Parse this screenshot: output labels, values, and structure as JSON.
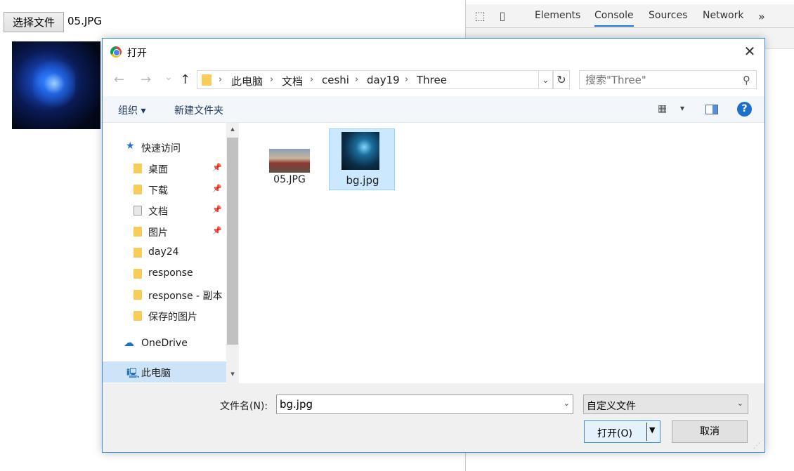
{
  "page": {
    "file_button_label": "选择文件",
    "selected_file_name": "05.JPG"
  },
  "devtools": {
    "tabs": [
      "Elements",
      "Console",
      "Sources",
      "Network"
    ],
    "active_tab": "Console",
    "more_tabs_glyph": "»"
  },
  "dialog": {
    "title": "打开",
    "close_glyph": "✕",
    "nav": {
      "back_glyph": "←",
      "forward_glyph": "→",
      "recent_glyph": "⌄",
      "up_glyph": "↑",
      "breadcrumbs": [
        "此电脑",
        "文档",
        "ceshi",
        "day19",
        "Three"
      ],
      "search_placeholder": "搜索\"Three\""
    },
    "toolbar": {
      "organize_label": "组织 ▾",
      "new_folder_label": "新建文件夹",
      "help_glyph": "?"
    },
    "sidebar": {
      "quick_access_label": "快速访问",
      "items": [
        {
          "label": "桌面",
          "pinned": true
        },
        {
          "label": "下载",
          "pinned": true
        },
        {
          "label": "文档",
          "pinned": true
        },
        {
          "label": "图片",
          "pinned": true
        },
        {
          "label": "day24",
          "pinned": false
        },
        {
          "label": "response",
          "pinned": false
        },
        {
          "label": "response - 副本",
          "pinned": false
        },
        {
          "label": "保存的图片",
          "pinned": false
        }
      ],
      "onedrive_label": "OneDrive",
      "this_pc_label": "此电脑"
    },
    "files": [
      {
        "name": "05.JPG",
        "selected": false
      },
      {
        "name": "bg.jpg",
        "selected": true
      }
    ],
    "bottom": {
      "filename_label": "文件名(N):",
      "filename_value": "bg.jpg",
      "filetype_value": "自定义文件",
      "open_label": "打开(O)",
      "cancel_label": "取消"
    }
  },
  "colors": {
    "accent": "#1a73e8",
    "dialog_border": "#3c8ddc",
    "selection": "#cce8ff",
    "folder": "#f7cc58"
  }
}
